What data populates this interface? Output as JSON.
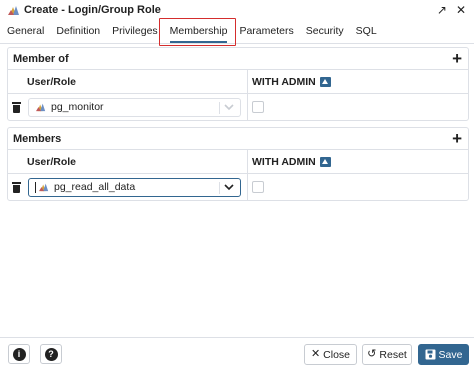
{
  "window": {
    "title": "Create - Login/Group Role",
    "title_icon": "group-role-icon",
    "expand_icon": "↗",
    "close_icon": "✕"
  },
  "tabs": [
    {
      "label": "General",
      "active": false
    },
    {
      "label": "Definition",
      "active": false
    },
    {
      "label": "Privileges",
      "active": false
    },
    {
      "label": "Membership",
      "active": true
    },
    {
      "label": "Parameters",
      "active": false
    },
    {
      "label": "Security",
      "active": false
    },
    {
      "label": "SQL",
      "active": false
    }
  ],
  "member_of": {
    "title": "Member of",
    "add_label": "+",
    "columns": {
      "user_role": "User/Role",
      "with_admin": "WITH ADMIN"
    },
    "rows": [
      {
        "role": "pg_monitor",
        "with_admin": false
      }
    ]
  },
  "members": {
    "title": "Members",
    "add_label": "+",
    "columns": {
      "user_role": "User/Role",
      "with_admin": "WITH ADMIN"
    },
    "rows": [
      {
        "role": "pg_read_all_data",
        "with_admin": false
      }
    ]
  },
  "footer": {
    "info_label": "i",
    "help_label": "?",
    "close_label": "Close",
    "close_icon": "✕",
    "reset_label": "Reset",
    "reset_icon": "↺",
    "save_label": "Save",
    "save_icon": "floppy-disk-icon"
  },
  "colors": {
    "accent": "#326690",
    "highlight": "#d42d2d",
    "border": "#dde0e6"
  }
}
